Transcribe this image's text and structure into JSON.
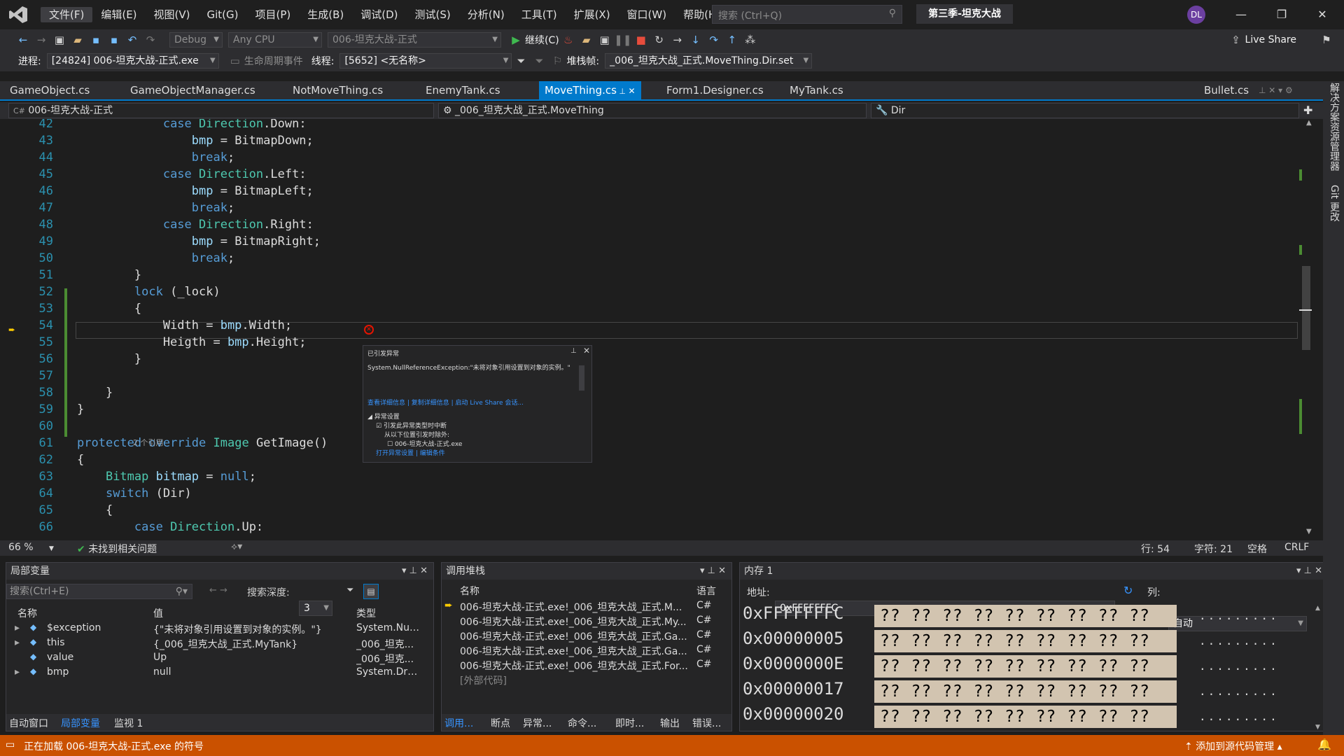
{
  "titlebar": {
    "menu": [
      "文件(F)",
      "编辑(E)",
      "视图(V)",
      "Git(G)",
      "项目(P)",
      "生成(B)",
      "调试(D)",
      "测试(S)",
      "分析(N)",
      "工具(T)",
      "扩展(X)",
      "窗口(W)",
      "帮助(H)"
    ],
    "search_placeholder": "搜索 (Ctrl+Q)",
    "solution_name": "第三季-坦克大战",
    "avatar_initials": "DL",
    "min_glyph": "—",
    "restore_glyph": "❐",
    "close_glyph": "✕"
  },
  "toolbar": {
    "config": "Debug",
    "platform": "Any CPU",
    "startup_project": "006-坦克大战-正式",
    "continue_label": "继续(C)",
    "live_share": "Live Share",
    "process_label": "进程:",
    "process_value": "[24824] 006-坦克大战-正式.exe",
    "lifecycle_label": "生命周期事件",
    "thread_label": "线程:",
    "thread_value": "[5652] <无名称>",
    "stackframe_label": "堆栈帧:",
    "stackframe_value": "_006_坦克大战_正式.MoveThing.Dir.set"
  },
  "tabs": {
    "items": [
      "GameObject.cs",
      "GameObjectManager.cs",
      "NotMoveThing.cs",
      "EnemyTank.cs",
      "MoveThing.cs",
      "Form1.Designer.cs",
      "MyTank.cs",
      "Bullet.cs"
    ],
    "active": "MoveThing.cs"
  },
  "navbar": {
    "project": "006-坦克大战-正式",
    "class": "_006_坦克大战_正式.MoveThing",
    "member": "Dir"
  },
  "editor": {
    "lines": [
      {
        "n": "42",
        "t": "            case Direction.Down:"
      },
      {
        "n": "43",
        "t": "                bmp = BitmapDown;"
      },
      {
        "n": "44",
        "t": "                break;"
      },
      {
        "n": "45",
        "t": "            case Direction.Left:"
      },
      {
        "n": "46",
        "t": "                bmp = BitmapLeft;"
      },
      {
        "n": "47",
        "t": "                break;"
      },
      {
        "n": "48",
        "t": "            case Direction.Right:"
      },
      {
        "n": "49",
        "t": "                bmp = BitmapRight;"
      },
      {
        "n": "50",
        "t": "                break;"
      },
      {
        "n": "51",
        "t": "        }"
      },
      {
        "n": "52",
        "t": "        lock (_lock)"
      },
      {
        "n": "53",
        "t": "        {"
      },
      {
        "n": "54",
        "t": "            Width = bmp.Width;"
      },
      {
        "n": "55",
        "t": "            Heigth = bmp.Height;"
      },
      {
        "n": "56",
        "t": "        }"
      },
      {
        "n": "57",
        "t": ""
      },
      {
        "n": "58",
        "t": "    }"
      },
      {
        "n": "59",
        "t": "}"
      },
      {
        "n": "60",
        "t": ""
      },
      {
        "n": "61",
        "t": "protected override Image GetImage()"
      },
      {
        "n": "62",
        "t": "{"
      },
      {
        "n": "63",
        "t": "    Bitmap bitmap = null;"
      },
      {
        "n": "64",
        "t": "    switch (Dir)"
      },
      {
        "n": "65",
        "t": "    {"
      },
      {
        "n": "66",
        "t": "        case Direction.Up:"
      }
    ],
    "codelens": "2 个引用"
  },
  "exception": {
    "title": "已引发异常",
    "message": "System.NullReferenceException:\"未将对象引用设置到对象的实例。\"",
    "links": "查看详细信息 | 复制详细信息 | 启动 Live Share 会话...",
    "settings_header": "异常设置",
    "opt1": "引发此异常类型时中断",
    "opt2": "从以下位置引发时除外:",
    "opt3": "006-坦克大战-正式.exe",
    "bottom_links": "打开异常设置 | 编辑条件"
  },
  "editor_status": {
    "zoom": "66 %",
    "issues": "未找到相关问题",
    "line": "行: 54",
    "char": "字符: 21",
    "space": "空格",
    "eol": "CRLF"
  },
  "locals": {
    "title": "局部变量",
    "search": "搜索(Ctrl+E)",
    "depth_label": "搜索深度:",
    "depth": "3",
    "cols": [
      "名称",
      "值",
      "类型"
    ],
    "rows": [
      {
        "name": "$exception",
        "value": "{\"未将对象引用设置到对象的实例。\"}",
        "type": "System.Null..."
      },
      {
        "name": "this",
        "value": "{_006_坦克大战_正式.MyTank}",
        "type": "_006_坦克..."
      },
      {
        "name": "value",
        "value": "Up",
        "type": "_006_坦克..."
      },
      {
        "name": "bmp",
        "value": "null",
        "type": "System.Dra..."
      }
    ],
    "tabs": [
      "自动窗口",
      "局部变量",
      "监视 1"
    ]
  },
  "callstack": {
    "title": "调用堆栈",
    "cols": [
      "名称",
      "语言"
    ],
    "rows": [
      {
        "name": "006-坦克大战-正式.exe!_006_坦克大战_正式.M...",
        "lang": "C#"
      },
      {
        "name": "006-坦克大战-正式.exe!_006_坦克大战_正式.My...",
        "lang": "C#"
      },
      {
        "name": "006-坦克大战-正式.exe!_006_坦克大战_正式.Ga...",
        "lang": "C#"
      },
      {
        "name": "006-坦克大战-正式.exe!_006_坦克大战_正式.Ga...",
        "lang": "C#"
      },
      {
        "name": "006-坦克大战-正式.exe!_006_坦克大战_正式.For...",
        "lang": "C#"
      },
      {
        "name": "[外部代码]",
        "lang": ""
      }
    ],
    "tabs": [
      "调用...",
      "断点",
      "异常...",
      "命令...",
      "即时...",
      "输出",
      "错误..."
    ]
  },
  "memory": {
    "title": "内存 1",
    "addr_label": "地址:",
    "addr": "0xFFFFFFFC",
    "col_label": "列:",
    "col": "自动",
    "rows": [
      {
        "addr": "0xFFFFFFFC",
        "bytes": "?? ?? ?? ?? ?? ?? ?? ?? ??",
        "dots": "........."
      },
      {
        "addr": "0x00000005",
        "bytes": "?? ?? ?? ?? ?? ?? ?? ?? ??",
        "dots": "........."
      },
      {
        "addr": "0x0000000E",
        "bytes": "?? ?? ?? ?? ?? ?? ?? ?? ??",
        "dots": "........."
      },
      {
        "addr": "0x00000017",
        "bytes": "?? ?? ?? ?? ?? ?? ?? ?? ??",
        "dots": "........."
      },
      {
        "addr": "0x00000020",
        "bytes": "?? ?? ?? ?? ?? ?? ?? ?? ??",
        "dots": "........."
      }
    ]
  },
  "statusbar": {
    "message": "正在加载 006-坦克大战-正式.exe 的符号",
    "source_control": "添加到源代码管理"
  },
  "sidestrip": {
    "item1": "解决方案资源管理器",
    "item2": "Git 更改"
  },
  "colors": {
    "accent": "#007acc",
    "status": "#ca5100",
    "highlight": "#e6d84a"
  }
}
